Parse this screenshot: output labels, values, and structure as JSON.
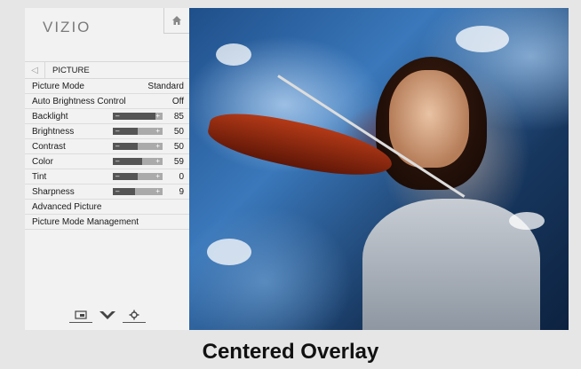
{
  "brand": "VIZIO",
  "menu": {
    "section_title": "PICTURE",
    "rows": [
      {
        "label": "Picture Mode",
        "value": "Standard"
      },
      {
        "label": "Auto Brightness Control",
        "value": "Off"
      }
    ],
    "sliders": [
      {
        "label": "Backlight",
        "value": "85",
        "fraction": 0.85
      },
      {
        "label": "Brightness",
        "value": "50",
        "fraction": 0.5
      },
      {
        "label": "Contrast",
        "value": "50",
        "fraction": 0.5
      },
      {
        "label": "Color",
        "value": "59",
        "fraction": 0.59
      },
      {
        "label": "Tint",
        "value": "0",
        "fraction": 0.5
      },
      {
        "label": "Sharpness",
        "value": "9",
        "fraction": 0.45
      }
    ],
    "links": [
      {
        "label": "Advanced Picture"
      },
      {
        "label": "Picture Mode Management"
      }
    ]
  },
  "slider_symbols": {
    "minus": "–",
    "plus": "+"
  },
  "icons": {
    "home": "home-icon",
    "back": "back-arrow-icon",
    "input": "input-icon",
    "chevron": "chevron-down-icon",
    "settings": "gear-icon"
  },
  "caption": "Centered Overlay"
}
